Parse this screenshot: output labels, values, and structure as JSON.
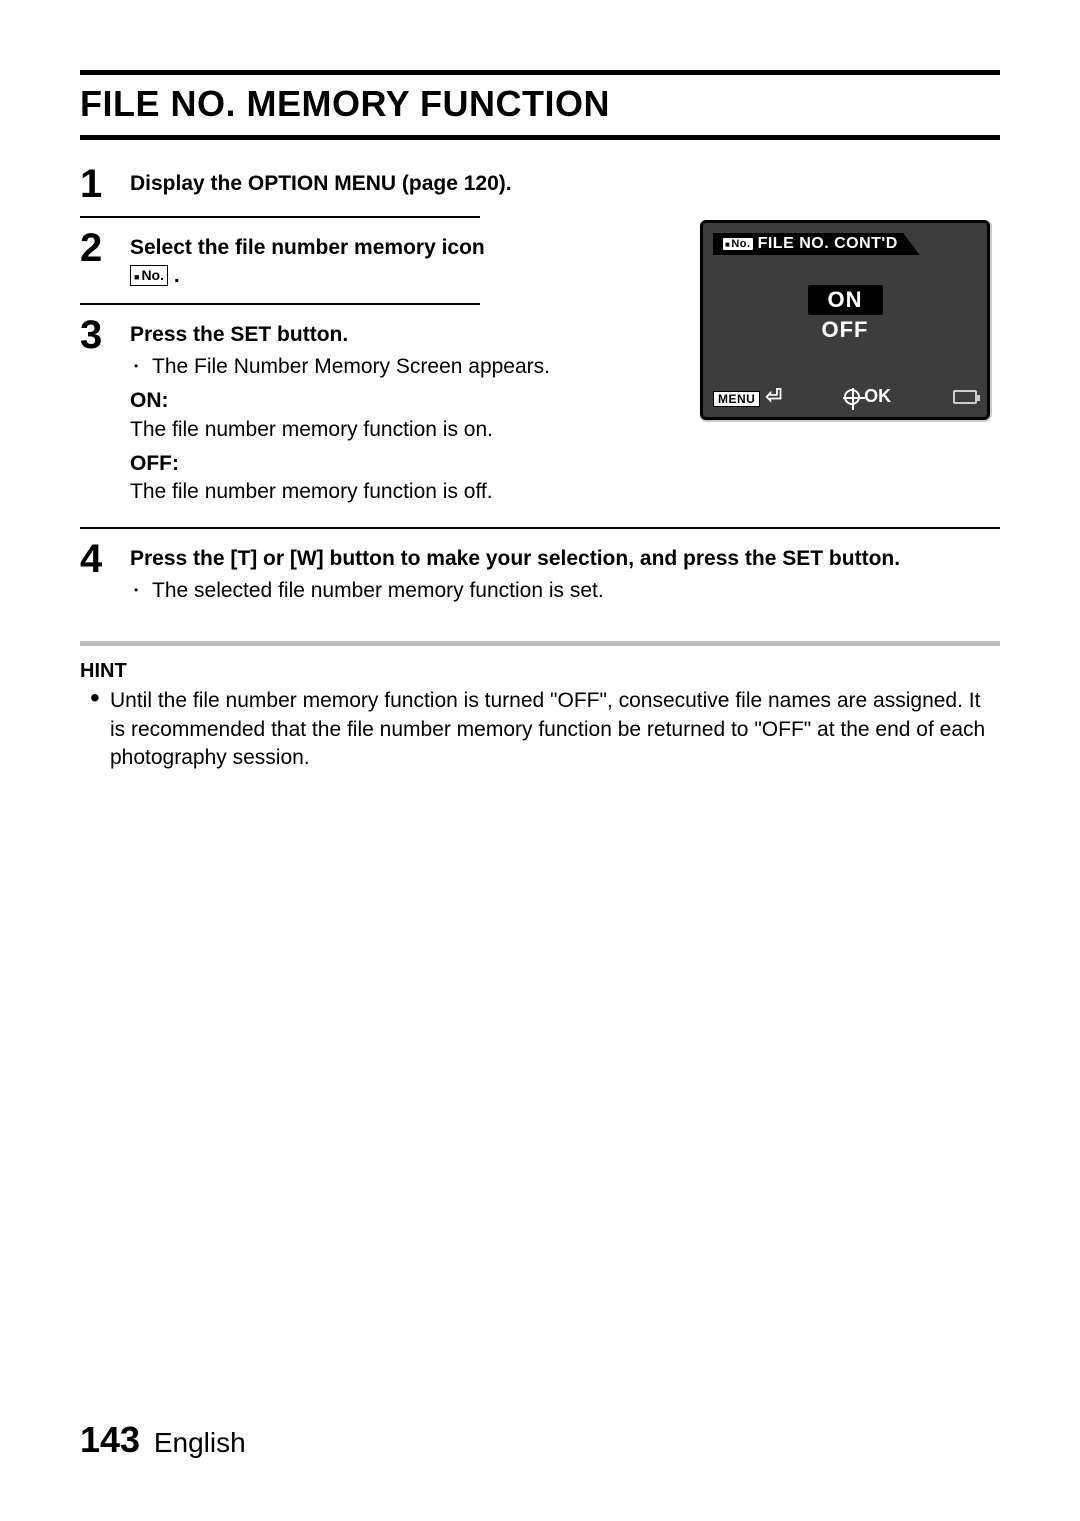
{
  "title": "FILE NO. MEMORY FUNCTION",
  "steps": {
    "s1": {
      "num": "1",
      "lead": "Display the OPTION MENU (page 120)."
    },
    "s2": {
      "num": "2",
      "lead_a": "Select the file number memory icon",
      "icon_label": "No.",
      "lead_b": "."
    },
    "s3": {
      "num": "3",
      "lead": "Press the SET button.",
      "bullet": "The File Number Memory Screen appears.",
      "on_label": "ON:",
      "on_text": "The file number memory function is on.",
      "off_label": "OFF:",
      "off_text": "The file number memory function is off."
    },
    "s4": {
      "num": "4",
      "lead": "Press the [T] or [W] button to make your selection, and press the SET button.",
      "bullet": "The selected file number memory function is set."
    }
  },
  "screen": {
    "tab_icon": "No.",
    "tab_text": "FILE NO. CONT'D",
    "opt_on": "ON",
    "opt_off": "OFF",
    "menu_label": "MENU",
    "ok_label": "OK"
  },
  "hint": {
    "title": "HINT",
    "text": "Until the file number memory function is turned \"OFF\", consecutive file names are assigned. It is recommended that the file number memory function be returned to \"OFF\" at the end of each photography session."
  },
  "footer": {
    "page": "143",
    "lang": "English"
  }
}
